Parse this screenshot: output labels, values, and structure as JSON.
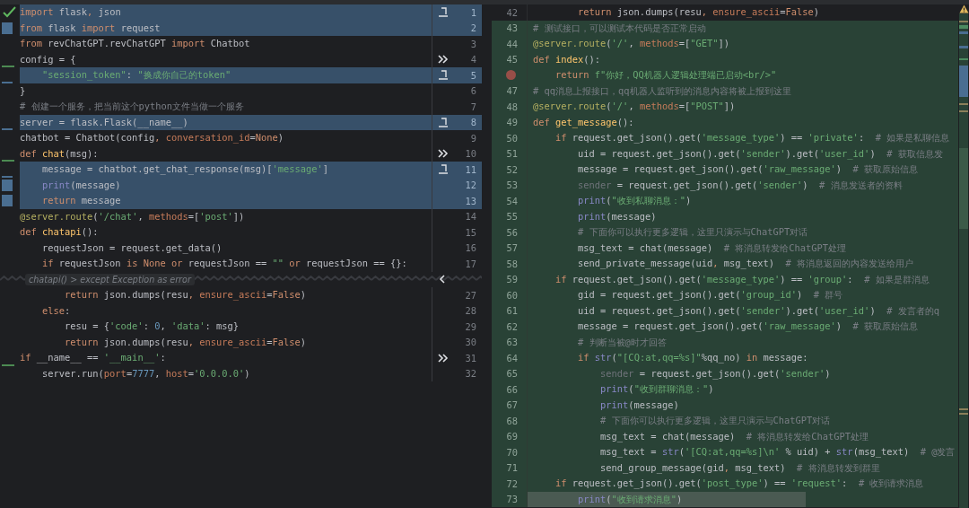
{
  "left": {
    "rows": [
      {
        "kind": "code",
        "num": "1",
        "highlighted": true,
        "marker": {
          "kind": "apply"
        },
        "segs": [
          {
            "kind": "keyword",
            "text": "import"
          },
          {
            "kind": "plain",
            "text": " flask"
          },
          {
            "kind": "keyword",
            "text": ","
          },
          {
            "kind": "plain",
            "text": " json"
          }
        ]
      },
      {
        "kind": "code",
        "num": "2",
        "highlighted": true,
        "segs": [
          {
            "kind": "keyword",
            "text": "from"
          },
          {
            "kind": "plain",
            "text": " flask "
          },
          {
            "kind": "keyword",
            "text": "import"
          },
          {
            "kind": "plain",
            "text": " request"
          }
        ]
      },
      {
        "kind": "code",
        "num": "3",
        "highlighted": false,
        "segs": [
          {
            "kind": "keyword",
            "text": "from"
          },
          {
            "kind": "plain",
            "text": " revChatGPT.revChatGPT "
          },
          {
            "kind": "keyword",
            "text": "import"
          },
          {
            "kind": "plain",
            "text": " Chatbot"
          }
        ]
      },
      {
        "kind": "code",
        "num": "4",
        "highlighted": false,
        "marker": {
          "kind": "merge"
        },
        "segs": [
          {
            "kind": "plain",
            "text": "config = {"
          }
        ]
      },
      {
        "kind": "code",
        "num": "5",
        "highlighted": true,
        "marker": {
          "kind": "apply"
        },
        "segs": [
          {
            "kind": "string",
            "text": "    \"session_token\""
          },
          {
            "kind": "plain",
            "text": ": "
          },
          {
            "kind": "string",
            "text": "\"换成你自己的token\""
          }
        ]
      },
      {
        "kind": "code",
        "num": "6",
        "highlighted": false,
        "segs": [
          {
            "kind": "plain",
            "text": "}"
          }
        ]
      },
      {
        "kind": "code",
        "num": "7",
        "highlighted": false,
        "segs": [
          {
            "kind": "comment",
            "text": "# 创建一个服务，把当前这个python文件当做一个服务"
          }
        ]
      },
      {
        "kind": "code",
        "num": "8",
        "highlighted": true,
        "marker": {
          "kind": "apply"
        },
        "segs": [
          {
            "kind": "plain",
            "text": "server = flask.Flask(__name__)"
          }
        ]
      },
      {
        "kind": "code",
        "num": "9",
        "highlighted": false,
        "segs": [
          {
            "kind": "plain",
            "text": "chatbot = Chatbot(config"
          },
          {
            "kind": "keyword",
            "text": ","
          },
          {
            "kind": "param",
            "text": " conversation_id"
          },
          {
            "kind": "plain",
            "text": "="
          },
          {
            "kind": "keyword",
            "text": "None"
          },
          {
            "kind": "plain",
            "text": ")"
          }
        ]
      },
      {
        "kind": "code",
        "num": "10",
        "highlighted": false,
        "marker": {
          "kind": "merge"
        },
        "segs": [
          {
            "kind": "keyword",
            "text": "def "
          },
          {
            "kind": "function",
            "text": "chat"
          },
          {
            "kind": "plain",
            "text": "(msg):"
          }
        ]
      },
      {
        "kind": "code",
        "num": "11",
        "highlighted": true,
        "marker": {
          "kind": "apply"
        },
        "segs": [
          {
            "kind": "plain",
            "text": "    message = chatbot.get_chat_response(msg)["
          },
          {
            "kind": "string",
            "text": "'message'"
          },
          {
            "kind": "plain",
            "text": "]"
          }
        ]
      },
      {
        "kind": "code",
        "num": "12",
        "highlighted": true,
        "segs": [
          {
            "kind": "builtin",
            "text": "    print"
          },
          {
            "kind": "plain",
            "text": "(message)"
          }
        ]
      },
      {
        "kind": "code",
        "num": "13",
        "highlighted": true,
        "segs": [
          {
            "kind": "keyword",
            "text": "    return"
          },
          {
            "kind": "plain",
            "text": " message"
          }
        ]
      },
      {
        "kind": "code",
        "num": "14",
        "highlighted": false,
        "segs": [
          {
            "kind": "decorator",
            "text": "@server.route"
          },
          {
            "kind": "plain",
            "text": "("
          },
          {
            "kind": "string",
            "text": "'/chat'"
          },
          {
            "kind": "plain",
            "text": ", "
          },
          {
            "kind": "param",
            "text": "methods"
          },
          {
            "kind": "plain",
            "text": "=["
          },
          {
            "kind": "string",
            "text": "'post'"
          },
          {
            "kind": "plain",
            "text": "])"
          }
        ]
      },
      {
        "kind": "code",
        "num": "15",
        "highlighted": false,
        "segs": [
          {
            "kind": "keyword",
            "text": "def "
          },
          {
            "kind": "function",
            "text": "chatapi"
          },
          {
            "kind": "plain",
            "text": "():"
          }
        ]
      },
      {
        "kind": "code",
        "num": "16",
        "highlighted": false,
        "segs": [
          {
            "kind": "plain",
            "text": "    requestJson = request.get_data()"
          }
        ]
      },
      {
        "kind": "code",
        "num": "17",
        "highlighted": false,
        "segs": [
          {
            "kind": "keyword",
            "text": "    if"
          },
          {
            "kind": "plain",
            "text": " requestJson "
          },
          {
            "kind": "keyword",
            "text": "is None or"
          },
          {
            "kind": "plain",
            "text": " requestJson == "
          },
          {
            "kind": "string",
            "text": "\"\""
          },
          {
            "kind": "keyword",
            "text": " or"
          },
          {
            "kind": "plain",
            "text": " requestJson == {}:"
          }
        ]
      },
      {
        "kind": "fold",
        "label": "chatapi() > except Exception as error"
      },
      {
        "kind": "code",
        "num": "27",
        "highlighted": false,
        "segs": [
          {
            "kind": "keyword",
            "text": "        return"
          },
          {
            "kind": "plain",
            "text": " json.dumps(resu"
          },
          {
            "kind": "keyword",
            "text": ","
          },
          {
            "kind": "param",
            "text": " ensure_ascii"
          },
          {
            "kind": "plain",
            "text": "="
          },
          {
            "kind": "keyword",
            "text": "False"
          },
          {
            "kind": "plain",
            "text": ")"
          }
        ]
      },
      {
        "kind": "code",
        "num": "28",
        "highlighted": false,
        "segs": [
          {
            "kind": "keyword",
            "text": "    else"
          },
          {
            "kind": "plain",
            "text": ":"
          }
        ]
      },
      {
        "kind": "code",
        "num": "29",
        "highlighted": false,
        "segs": [
          {
            "kind": "plain",
            "text": "        resu = {"
          },
          {
            "kind": "string",
            "text": "'code'"
          },
          {
            "kind": "plain",
            "text": ": "
          },
          {
            "kind": "number",
            "text": "0"
          },
          {
            "kind": "plain",
            "text": ", "
          },
          {
            "kind": "string",
            "text": "'data'"
          },
          {
            "kind": "plain",
            "text": ": msg}"
          }
        ]
      },
      {
        "kind": "code",
        "num": "30",
        "highlighted": false,
        "segs": [
          {
            "kind": "keyword",
            "text": "        return"
          },
          {
            "kind": "plain",
            "text": " json.dumps(resu"
          },
          {
            "kind": "keyword",
            "text": ","
          },
          {
            "kind": "param",
            "text": " ensure_ascii"
          },
          {
            "kind": "plain",
            "text": "="
          },
          {
            "kind": "keyword",
            "text": "False"
          },
          {
            "kind": "plain",
            "text": ")"
          }
        ]
      },
      {
        "kind": "code",
        "num": "31",
        "highlighted": false,
        "marker": {
          "kind": "merge"
        },
        "segs": [
          {
            "kind": "keyword",
            "text": "if"
          },
          {
            "kind": "plain",
            "text": " __name__ == "
          },
          {
            "kind": "string",
            "text": "'__main__'"
          },
          {
            "kind": "plain",
            "text": ":"
          }
        ]
      },
      {
        "kind": "code",
        "num": "32",
        "highlighted": false,
        "segs": [
          {
            "kind": "plain",
            "text": "    server.run("
          },
          {
            "kind": "param",
            "text": "port"
          },
          {
            "kind": "plain",
            "text": "="
          },
          {
            "kind": "number",
            "text": "7777"
          },
          {
            "kind": "plain",
            "text": ", "
          },
          {
            "kind": "param",
            "text": "host"
          },
          {
            "kind": "plain",
            "text": "="
          },
          {
            "kind": "string",
            "text": "'0.0.0.0'"
          },
          {
            "kind": "plain",
            "text": ")"
          }
        ]
      }
    ]
  },
  "right": {
    "rows": [
      {
        "num": "42",
        "added": false,
        "segs": [
          {
            "kind": "keyword",
            "text": "        return"
          },
          {
            "kind": "plain",
            "text": " json.dumps(resu"
          },
          {
            "kind": "keyword",
            "text": ","
          },
          {
            "kind": "param",
            "text": " ensure_ascii"
          },
          {
            "kind": "plain",
            "text": "="
          },
          {
            "kind": "keyword",
            "text": "False"
          },
          {
            "kind": "plain",
            "text": ")"
          }
        ]
      },
      {
        "num": "43",
        "added": true,
        "segs": [
          {
            "kind": "comment",
            "text": "# 测试接口，可以测试本代码是否正常启动"
          }
        ]
      },
      {
        "num": "44",
        "added": true,
        "segs": [
          {
            "kind": "decorator",
            "text": "@server.route"
          },
          {
            "kind": "plain",
            "text": "("
          },
          {
            "kind": "string",
            "text": "'/'"
          },
          {
            "kind": "plain",
            "text": ", "
          },
          {
            "kind": "param",
            "text": "methods"
          },
          {
            "kind": "plain",
            "text": "=["
          },
          {
            "kind": "string",
            "text": "\"GET\""
          },
          {
            "kind": "plain",
            "text": "])"
          }
        ]
      },
      {
        "num": "45",
        "added": true,
        "segs": [
          {
            "kind": "keyword",
            "text": "def "
          },
          {
            "kind": "function",
            "text": "index"
          },
          {
            "kind": "plain",
            "text": "():"
          }
        ]
      },
      {
        "added": true,
        "breakpoint": true,
        "segs": [
          {
            "kind": "keyword",
            "text": "    return"
          },
          {
            "kind": "string",
            "text": " f\"你好，QQ机器人逻辑处理端已启动<br/>\""
          }
        ]
      },
      {
        "num": "47",
        "added": true,
        "segs": [
          {
            "kind": "comment",
            "text": "# qq消息上报接口，qq机器人监听到的消息内容将被上报到这里"
          }
        ]
      },
      {
        "num": "48",
        "added": true,
        "segs": [
          {
            "kind": "decorator",
            "text": "@server.route"
          },
          {
            "kind": "plain",
            "text": "("
          },
          {
            "kind": "string",
            "text": "'/'"
          },
          {
            "kind": "plain",
            "text": ", "
          },
          {
            "kind": "param",
            "text": "methods"
          },
          {
            "kind": "plain",
            "text": "=["
          },
          {
            "kind": "string",
            "text": "\"POST\""
          },
          {
            "kind": "plain",
            "text": "])"
          }
        ]
      },
      {
        "num": "49",
        "added": true,
        "segs": [
          {
            "kind": "keyword",
            "text": "def "
          },
          {
            "kind": "function",
            "text": "get_message"
          },
          {
            "kind": "plain",
            "text": "():"
          }
        ]
      },
      {
        "num": "50",
        "added": true,
        "segs": [
          {
            "kind": "keyword",
            "text": "    if"
          },
          {
            "kind": "plain",
            "text": " request.get_json().get("
          },
          {
            "kind": "string",
            "text": "'message_type'"
          },
          {
            "kind": "plain",
            "text": ") == "
          },
          {
            "kind": "string",
            "text": "'private'"
          },
          {
            "kind": "plain",
            "text": ":"
          },
          {
            "kind": "comment",
            "text": "  # 如果是私聊信息"
          }
        ]
      },
      {
        "num": "51",
        "added": true,
        "segs": [
          {
            "kind": "plain",
            "text": "        uid = request.get_json().get("
          },
          {
            "kind": "string",
            "text": "'sender'"
          },
          {
            "kind": "plain",
            "text": ").get("
          },
          {
            "kind": "string",
            "text": "'user_id'"
          },
          {
            "kind": "plain",
            "text": ")"
          },
          {
            "kind": "comment",
            "text": "  # 获取信息发"
          }
        ]
      },
      {
        "num": "52",
        "added": true,
        "segs": [
          {
            "kind": "plain",
            "text": "        message = request.get_json().get("
          },
          {
            "kind": "string",
            "text": "'raw_message'"
          },
          {
            "kind": "plain",
            "text": ")"
          },
          {
            "kind": "comment",
            "text": "  # 获取原始信息"
          }
        ]
      },
      {
        "num": "53",
        "added": true,
        "segs": [
          {
            "kind": "unused",
            "text": "        sender"
          },
          {
            "kind": "plain",
            "text": " = request.get_json().get("
          },
          {
            "kind": "string",
            "text": "'sender'"
          },
          {
            "kind": "plain",
            "text": ")"
          },
          {
            "kind": "comment",
            "text": "  # 消息发送者的资料"
          }
        ]
      },
      {
        "num": "54",
        "added": true,
        "segs": [
          {
            "kind": "builtin",
            "text": "        print"
          },
          {
            "kind": "plain",
            "text": "("
          },
          {
            "kind": "string",
            "text": "\"收到私聊消息：\""
          },
          {
            "kind": "plain",
            "text": ")"
          }
        ]
      },
      {
        "num": "55",
        "added": true,
        "segs": [
          {
            "kind": "builtin",
            "text": "        print"
          },
          {
            "kind": "plain",
            "text": "(message)"
          }
        ]
      },
      {
        "num": "56",
        "added": true,
        "segs": [
          {
            "kind": "comment",
            "text": "        # 下面你可以执行更多逻辑，这里只演示与ChatGPT对话"
          }
        ]
      },
      {
        "num": "57",
        "added": true,
        "segs": [
          {
            "kind": "plain",
            "text": "        msg_text = chat(message)"
          },
          {
            "kind": "comment",
            "text": "  # 将消息转发给ChatGPT处理"
          }
        ]
      },
      {
        "num": "58",
        "added": true,
        "segs": [
          {
            "kind": "plain",
            "text": "        send_private_message(uid"
          },
          {
            "kind": "keyword",
            "text": ","
          },
          {
            "kind": "plain",
            "text": " msg_text)"
          },
          {
            "kind": "comment",
            "text": "  # 将消息返回的内容发送给用户"
          }
        ]
      },
      {
        "num": "59",
        "added": true,
        "segs": [
          {
            "kind": "keyword",
            "text": "    if"
          },
          {
            "kind": "plain",
            "text": " request.get_json().get("
          },
          {
            "kind": "string",
            "text": "'message_type'"
          },
          {
            "kind": "plain",
            "text": ") == "
          },
          {
            "kind": "string",
            "text": "'group'"
          },
          {
            "kind": "plain",
            "text": ":"
          },
          {
            "kind": "comment",
            "text": "  # 如果是群消息"
          }
        ]
      },
      {
        "num": "60",
        "added": true,
        "segs": [
          {
            "kind": "plain",
            "text": "        gid = request.get_json().get("
          },
          {
            "kind": "string",
            "text": "'group_id'"
          },
          {
            "kind": "plain",
            "text": ")"
          },
          {
            "kind": "comment",
            "text": "  # 群号"
          }
        ]
      },
      {
        "num": "61",
        "added": true,
        "segs": [
          {
            "kind": "plain",
            "text": "        uid = request.get_json().get("
          },
          {
            "kind": "string",
            "text": "'sender'"
          },
          {
            "kind": "plain",
            "text": ").get("
          },
          {
            "kind": "string",
            "text": "'user_id'"
          },
          {
            "kind": "plain",
            "text": ")"
          },
          {
            "kind": "comment",
            "text": "  # 发言者的q"
          }
        ]
      },
      {
        "num": "62",
        "added": true,
        "segs": [
          {
            "kind": "plain",
            "text": "        message = request.get_json().get("
          },
          {
            "kind": "string",
            "text": "'raw_message'"
          },
          {
            "kind": "plain",
            "text": ")"
          },
          {
            "kind": "comment",
            "text": "  # 获取原始信息"
          }
        ]
      },
      {
        "num": "63",
        "added": true,
        "segs": [
          {
            "kind": "comment",
            "text": "        # 判断当被@时才回答"
          }
        ]
      },
      {
        "num": "64",
        "added": true,
        "segs": [
          {
            "kind": "keyword",
            "text": "        if"
          },
          {
            "kind": "builtin",
            "text": " str"
          },
          {
            "kind": "plain",
            "text": "("
          },
          {
            "kind": "string",
            "text": "\"[CQ:at,qq=%s]\""
          },
          {
            "kind": "plain",
            "text": "%qq_no) "
          },
          {
            "kind": "keyword",
            "text": "in"
          },
          {
            "kind": "plain",
            "text": " message:"
          }
        ]
      },
      {
        "num": "65",
        "added": true,
        "segs": [
          {
            "kind": "unused",
            "text": "            sender"
          },
          {
            "kind": "plain",
            "text": " = request.get_json().get("
          },
          {
            "kind": "string",
            "text": "'sender'"
          },
          {
            "kind": "plain",
            "text": ")"
          }
        ]
      },
      {
        "num": "66",
        "added": true,
        "segs": [
          {
            "kind": "builtin",
            "text": "            print"
          },
          {
            "kind": "plain",
            "text": "("
          },
          {
            "kind": "string",
            "text": "\"收到群聊消息：\""
          },
          {
            "kind": "plain",
            "text": ")"
          }
        ]
      },
      {
        "num": "67",
        "added": true,
        "segs": [
          {
            "kind": "builtin",
            "text": "            print"
          },
          {
            "kind": "plain",
            "text": "(message)"
          }
        ]
      },
      {
        "num": "68",
        "added": true,
        "segs": [
          {
            "kind": "comment",
            "text": "            # 下面你可以执行更多逻辑，这里只演示与ChatGPT对话"
          }
        ]
      },
      {
        "num": "69",
        "added": true,
        "segs": [
          {
            "kind": "plain",
            "text": "            msg_text = chat(message)"
          },
          {
            "kind": "comment",
            "text": "  # 将消息转发给ChatGPT处理"
          }
        ]
      },
      {
        "num": "70",
        "added": true,
        "segs": [
          {
            "kind": "plain",
            "text": "            msg_text = "
          },
          {
            "kind": "builtin",
            "text": "str"
          },
          {
            "kind": "plain",
            "text": "("
          },
          {
            "kind": "string",
            "text": "'[CQ:at,qq=%s]\\n'"
          },
          {
            "kind": "plain",
            "text": " % uid) + "
          },
          {
            "kind": "builtin",
            "text": "str"
          },
          {
            "kind": "plain",
            "text": "(msg_text)"
          },
          {
            "kind": "comment",
            "text": "  # @发言"
          }
        ]
      },
      {
        "num": "71",
        "added": true,
        "segs": [
          {
            "kind": "plain",
            "text": "            send_group_message(gid"
          },
          {
            "kind": "keyword",
            "text": ","
          },
          {
            "kind": "plain",
            "text": " msg_text)"
          },
          {
            "kind": "comment",
            "text": "  # 将消息转发到群里"
          }
        ]
      },
      {
        "num": "72",
        "added": true,
        "segs": [
          {
            "kind": "keyword",
            "text": "    if"
          },
          {
            "kind": "plain",
            "text": " request.get_json().get("
          },
          {
            "kind": "string",
            "text": "'post_type'"
          },
          {
            "kind": "plain",
            "text": ") == "
          },
          {
            "kind": "string",
            "text": "'request'"
          },
          {
            "kind": "plain",
            "text": ":"
          },
          {
            "kind": "comment",
            "text": "  # 收到请求消息"
          }
        ]
      },
      {
        "num": "73",
        "added": true,
        "current": true,
        "segs": [
          {
            "kind": "builtin",
            "text": "        print"
          },
          {
            "kind": "plain",
            "text": "("
          },
          {
            "kind": "string",
            "text": "\"收到请求消息\""
          },
          {
            "kind": "plain",
            "text": ")"
          }
        ]
      }
    ]
  }
}
